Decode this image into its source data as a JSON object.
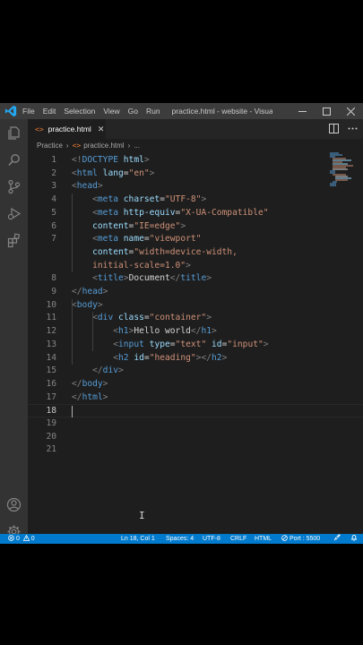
{
  "titlebar": {
    "menu": [
      "File",
      "Edit",
      "Selection",
      "View",
      "Go",
      "Run"
    ],
    "window_title": "practice.html - website - Visua..."
  },
  "tab": {
    "icon_text": "<>",
    "label": "practice.html",
    "close": "✕"
  },
  "breadcrumb": {
    "folder": "Practice",
    "file": "practice.html",
    "more": "..."
  },
  "editor": {
    "current_line": 18,
    "lines": [
      {
        "n": 1,
        "tokens": [
          [
            "t-punct",
            "<!"
          ],
          [
            "t-tag",
            "DOCTYPE"
          ],
          [
            "t-text",
            " "
          ],
          [
            "t-attr",
            "html"
          ],
          [
            "t-punct",
            ">"
          ]
        ]
      },
      {
        "n": 2,
        "tokens": [
          [
            "t-punct",
            "<"
          ],
          [
            "t-tag",
            "html"
          ],
          [
            "t-text",
            " "
          ],
          [
            "t-attr",
            "lang"
          ],
          [
            "t-text",
            "="
          ],
          [
            "t-str",
            "\"en\""
          ],
          [
            "t-punct",
            ">"
          ]
        ]
      },
      {
        "n": 3,
        "tokens": [
          [
            "t-punct",
            "<"
          ],
          [
            "t-tag",
            "head"
          ],
          [
            "t-punct",
            ">"
          ]
        ]
      },
      {
        "n": 4,
        "tokens": [
          [
            "t-text",
            "    "
          ],
          [
            "t-punct",
            "<"
          ],
          [
            "t-tag",
            "meta"
          ],
          [
            "t-text",
            " "
          ],
          [
            "t-attr",
            "charset"
          ],
          [
            "t-text",
            "="
          ],
          [
            "t-str",
            "\"UTF-8\""
          ],
          [
            "t-punct",
            ">"
          ]
        ]
      },
      {
        "n": 5,
        "tokens": [
          [
            "t-text",
            "    "
          ],
          [
            "t-punct",
            "<"
          ],
          [
            "t-tag",
            "meta"
          ],
          [
            "t-text",
            " "
          ],
          [
            "t-attr",
            "http-equiv"
          ],
          [
            "t-text",
            "="
          ],
          [
            "t-str",
            "\"X-UA-Compatible\""
          ]
        ]
      },
      {
        "n": 6,
        "tokens": [
          [
            "t-text",
            "    "
          ],
          [
            "t-attr",
            "content"
          ],
          [
            "t-text",
            "="
          ],
          [
            "t-str",
            "\"IE=edge\""
          ],
          [
            "t-punct",
            ">"
          ]
        ]
      },
      {
        "n": 7,
        "tokens": [
          [
            "t-text",
            "    "
          ],
          [
            "t-punct",
            "<"
          ],
          [
            "t-tag",
            "meta"
          ],
          [
            "t-text",
            " "
          ],
          [
            "t-attr",
            "name"
          ],
          [
            "t-text",
            "="
          ],
          [
            "t-str",
            "\"viewport\""
          ]
        ]
      },
      {
        "n": "",
        "tokens": [
          [
            "t-text",
            "    "
          ],
          [
            "t-attr",
            "content"
          ],
          [
            "t-text",
            "="
          ],
          [
            "t-str",
            "\"width=device-width,"
          ]
        ]
      },
      {
        "n": "",
        "tokens": [
          [
            "t-text",
            "    "
          ],
          [
            "t-str",
            "initial-scale=1.0\""
          ],
          [
            "t-punct",
            ">"
          ]
        ]
      },
      {
        "n": 8,
        "tokens": [
          [
            "t-text",
            "    "
          ],
          [
            "t-punct",
            "<"
          ],
          [
            "t-tag",
            "title"
          ],
          [
            "t-punct",
            ">"
          ],
          [
            "t-text",
            "Document"
          ],
          [
            "t-punct",
            "</"
          ],
          [
            "t-tag",
            "title"
          ],
          [
            "t-punct",
            ">"
          ]
        ]
      },
      {
        "n": 9,
        "tokens": [
          [
            "t-punct",
            "</"
          ],
          [
            "t-tag",
            "head"
          ],
          [
            "t-punct",
            ">"
          ]
        ]
      },
      {
        "n": 10,
        "tokens": [
          [
            "t-punct",
            "<"
          ],
          [
            "t-tag",
            "body"
          ],
          [
            "t-punct",
            ">"
          ]
        ]
      },
      {
        "n": 11,
        "tokens": [
          [
            "t-text",
            "    "
          ],
          [
            "t-punct",
            "<"
          ],
          [
            "t-tag",
            "div"
          ],
          [
            "t-text",
            " "
          ],
          [
            "t-attr",
            "class"
          ],
          [
            "t-text",
            "="
          ],
          [
            "t-str",
            "\"container\""
          ],
          [
            "t-punct",
            ">"
          ]
        ]
      },
      {
        "n": 12,
        "tokens": [
          [
            "t-text",
            "        "
          ],
          [
            "t-punct",
            "<"
          ],
          [
            "t-tag",
            "h1"
          ],
          [
            "t-punct",
            ">"
          ],
          [
            "t-text",
            "Hello world"
          ],
          [
            "t-punct",
            "</"
          ],
          [
            "t-tag",
            "h1"
          ],
          [
            "t-punct",
            ">"
          ]
        ]
      },
      {
        "n": 13,
        "tokens": [
          [
            "t-text",
            "        "
          ],
          [
            "t-punct",
            "<"
          ],
          [
            "t-tag",
            "input"
          ],
          [
            "t-text",
            " "
          ],
          [
            "t-attr",
            "type"
          ],
          [
            "t-text",
            "="
          ],
          [
            "t-str",
            "\"text\""
          ],
          [
            "t-text",
            " "
          ],
          [
            "t-attr",
            "id"
          ],
          [
            "t-text",
            "="
          ],
          [
            "t-str",
            "\"input\""
          ],
          [
            "t-punct",
            ">"
          ]
        ]
      },
      {
        "n": 14,
        "tokens": [
          [
            "t-text",
            "        "
          ],
          [
            "t-punct",
            "<"
          ],
          [
            "t-tag",
            "h2"
          ],
          [
            "t-text",
            " "
          ],
          [
            "t-attr",
            "id"
          ],
          [
            "t-text",
            "="
          ],
          [
            "t-str",
            "\"heading\""
          ],
          [
            "t-punct",
            "></"
          ],
          [
            "t-tag",
            "h2"
          ],
          [
            "t-punct",
            ">"
          ]
        ]
      },
      {
        "n": 15,
        "tokens": [
          [
            "t-text",
            "    "
          ],
          [
            "t-punct",
            "</"
          ],
          [
            "t-tag",
            "div"
          ],
          [
            "t-punct",
            ">"
          ]
        ]
      },
      {
        "n": 16,
        "tokens": [
          [
            "t-punct",
            "</"
          ],
          [
            "t-tag",
            "body"
          ],
          [
            "t-punct",
            ">"
          ]
        ]
      },
      {
        "n": 17,
        "tokens": [
          [
            "t-punct",
            "</"
          ],
          [
            "t-tag",
            "html"
          ],
          [
            "t-punct",
            ">"
          ]
        ]
      },
      {
        "n": 18,
        "tokens": []
      },
      {
        "n": 19,
        "tokens": []
      },
      {
        "n": 20,
        "tokens": []
      },
      {
        "n": 21,
        "tokens": []
      }
    ]
  },
  "statusbar": {
    "errors": "0",
    "warnings": "0",
    "position": "Ln 18, Col 1",
    "spaces": "Spaces: 4",
    "encoding": "UTF-8",
    "eol": "CRLF",
    "language": "HTML",
    "port": "Port : 5500"
  },
  "colors": {
    "accent": "#007acc",
    "titlebar": "#3c3c3c",
    "activitybar": "#333333",
    "editor_bg": "#1e1e1e",
    "tag": "#569cd6",
    "attribute": "#9cdcfe",
    "string": "#ce9178",
    "html_icon": "#e37933"
  },
  "icons": [
    "vscode-logo-icon",
    "explorer-icon",
    "search-icon",
    "source-control-icon",
    "run-debug-icon",
    "extensions-icon",
    "account-icon",
    "settings-gear-icon",
    "split-editor-icon",
    "more-actions-icon",
    "minimize-icon",
    "maximize-icon",
    "close-icon",
    "error-icon",
    "warning-icon",
    "port-icon",
    "feedback-icon",
    "bell-icon"
  ]
}
